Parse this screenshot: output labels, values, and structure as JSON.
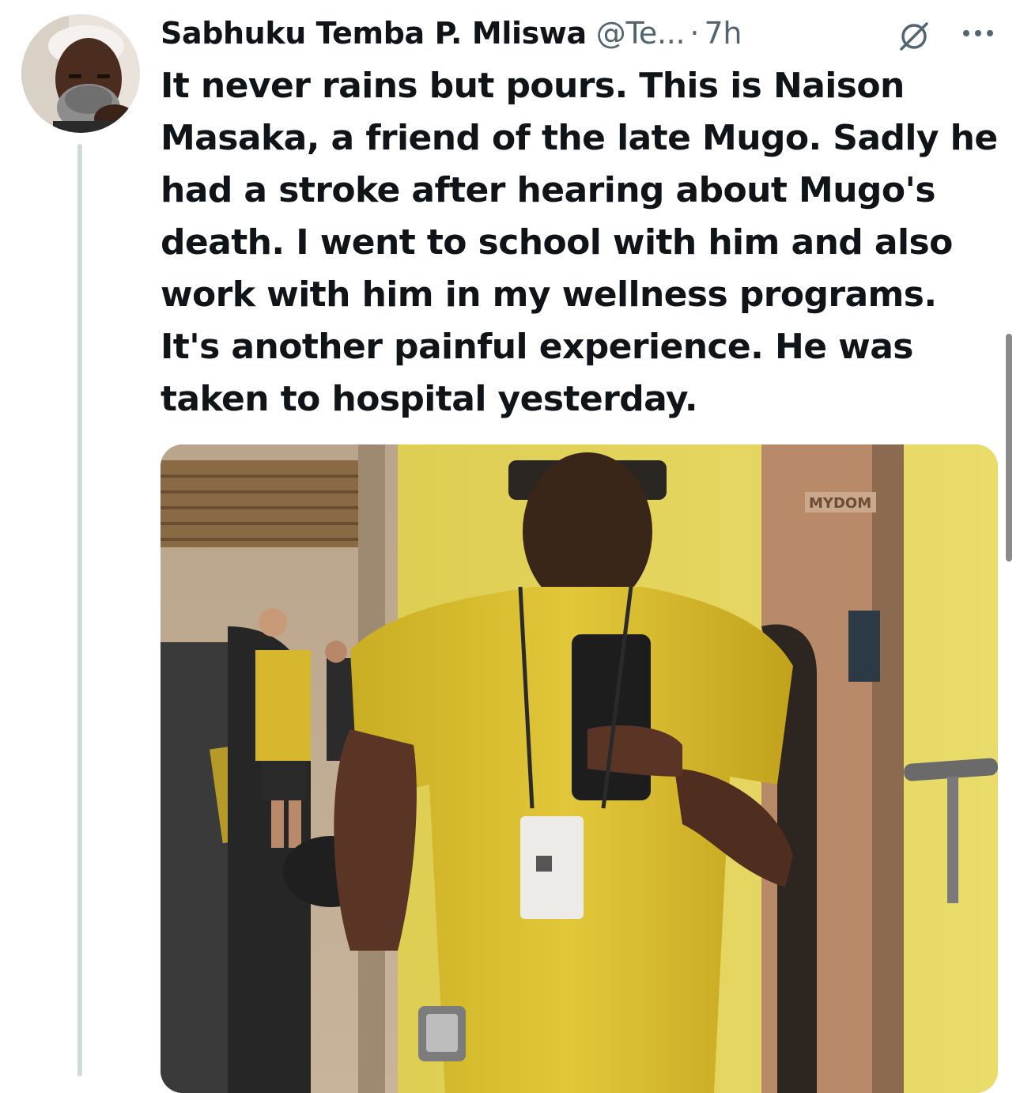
{
  "tweet": {
    "display_name": "Sabhuku Temba P. Mliswa",
    "handle": "@Te...",
    "separator": "·",
    "time": "7h",
    "text": "It never rains but pours. This is Naison Masaka, a friend of the late Mugo. Sadly he had a stroke after hearing about Mugo's death. I went to school with him and also work with him in my wellness programs. It's another painful experience. He was taken to hospital yesterday.",
    "media_sign_text": "MYDOM"
  },
  "icons": {
    "grok": "grok-icon",
    "more": "more-options-icon"
  },
  "colors": {
    "text_primary": "#0f1419",
    "text_secondary": "#536471",
    "thread_line": "#cfd9de"
  }
}
